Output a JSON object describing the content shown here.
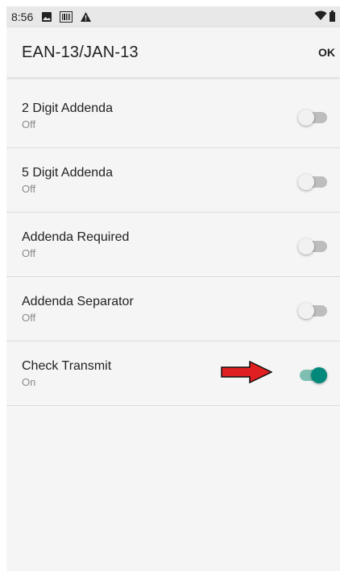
{
  "status_bar": {
    "time": "8:56"
  },
  "app_bar": {
    "title": "EAN-13/JAN-13",
    "ok_label": "OK"
  },
  "settings": [
    {
      "label": "2 Digit Addenda",
      "summary": "Off",
      "enabled": false
    },
    {
      "label": "5 Digit Addenda",
      "summary": "Off",
      "enabled": false
    },
    {
      "label": "Addenda Required",
      "summary": "Off",
      "enabled": false
    },
    {
      "label": "Addenda Separator",
      "summary": "Off",
      "enabled": false
    },
    {
      "label": "Check Transmit",
      "summary": "On",
      "enabled": true
    }
  ],
  "colors": {
    "accent": "#00897b",
    "accent_track": "#7fbfb2",
    "annotation_arrow": "#e02020"
  }
}
